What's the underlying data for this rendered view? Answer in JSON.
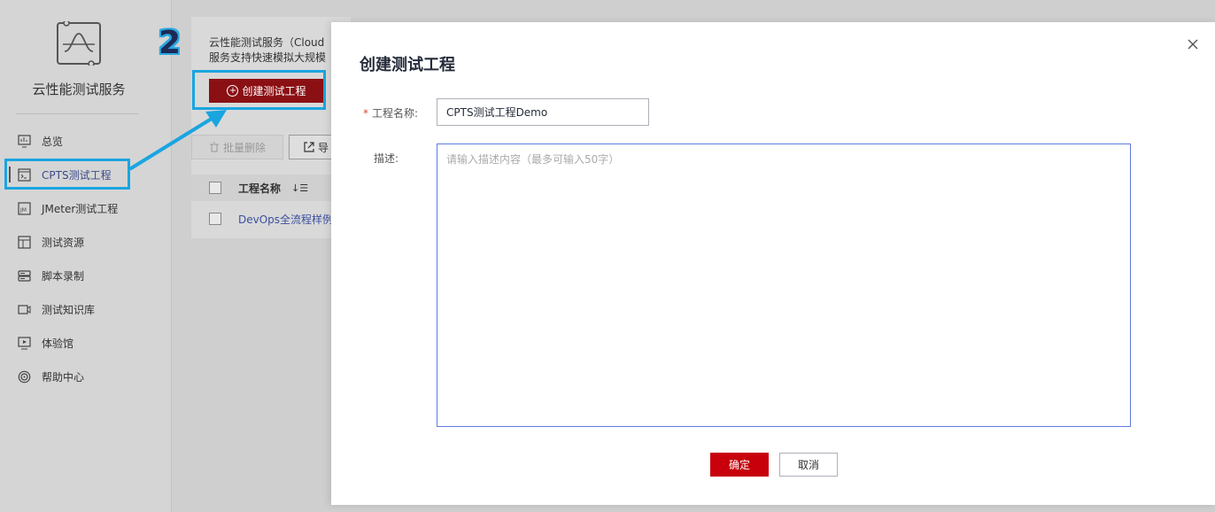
{
  "sidebar": {
    "service_title": "云性能测试服务",
    "items": [
      {
        "label": "总览",
        "icon": "chart-board-icon"
      },
      {
        "label": "CPTS测试工程",
        "icon": "terminal-icon"
      },
      {
        "label": "JMeter测试工程",
        "icon": "jmeter-icon"
      },
      {
        "label": "测试资源",
        "icon": "resource-grid-icon"
      },
      {
        "label": "脚本录制",
        "icon": "script-record-icon"
      },
      {
        "label": "测试知识库",
        "icon": "video-library-icon"
      },
      {
        "label": "体验馆",
        "icon": "play-screen-icon"
      },
      {
        "label": "帮助中心",
        "icon": "target-help-icon"
      }
    ]
  },
  "main": {
    "intro_line1": "云性能测试服务（Cloud",
    "intro_line2": "服务支持快速模拟大规模",
    "create_button": "创建测试工程",
    "batch_delete_button": "批量删除",
    "export_button": "导",
    "table": {
      "header_name": "工程名称",
      "rows": [
        {
          "name": "DevOps全流程样例"
        }
      ]
    }
  },
  "annotation": {
    "step_number": "2",
    "accent_color": "#1aa5e0"
  },
  "modal": {
    "title": "创建测试工程",
    "name_label": "工程名称:",
    "name_value": "CPTS测试工程Demo",
    "desc_label": "描述:",
    "desc_placeholder": "请输入描述内容（最多可输入50字）",
    "ok_button": "确定",
    "cancel_button": "取消"
  },
  "colors": {
    "primary_red": "#c7000b",
    "dark_red": "#8b1014",
    "link_blue": "#3c4f9e"
  }
}
